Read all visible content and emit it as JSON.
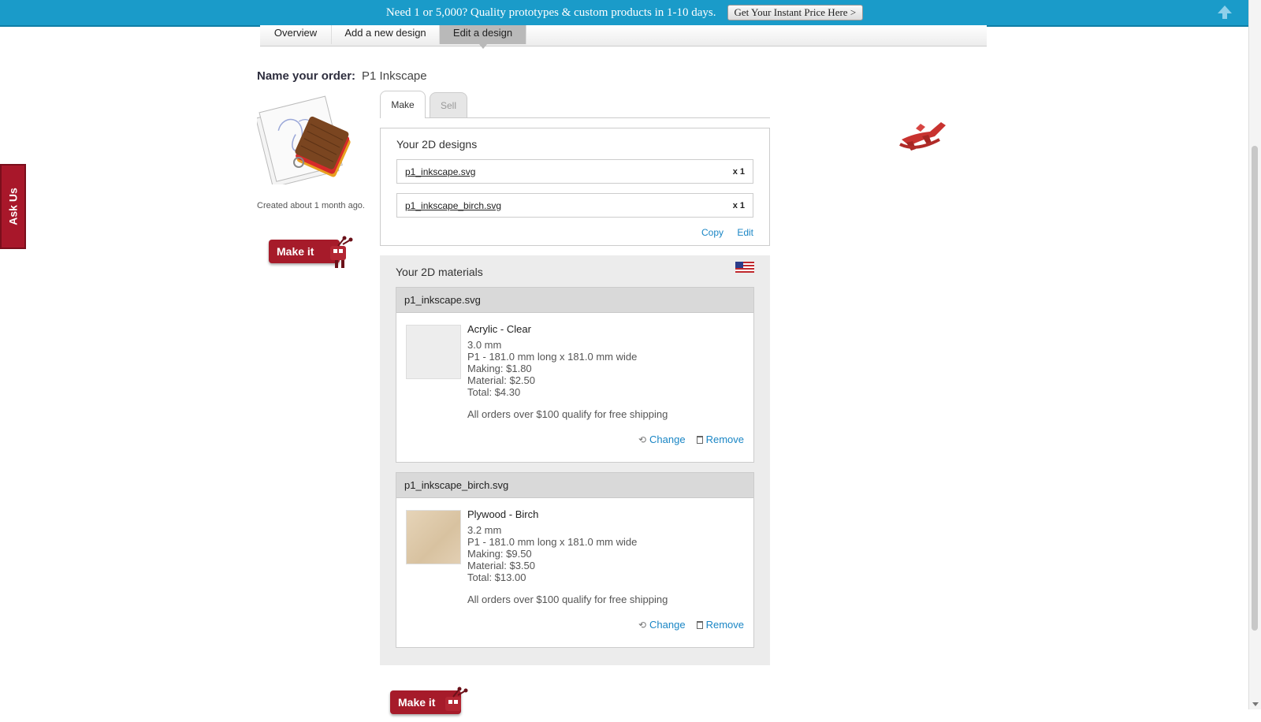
{
  "promo": {
    "text": "Need 1 or 5,000? Quality prototypes & custom products in 1-10 days.",
    "button": "Get Your Instant Price Here >"
  },
  "subnav": {
    "items": [
      "Overview",
      "Add a new design",
      "Edit a design"
    ],
    "active": "Edit a design"
  },
  "side_tab": "Ask Us",
  "order": {
    "label": "Name your order:",
    "name": "P1 Inkscape",
    "created": "Created about 1 month ago.",
    "make_it": "Make it"
  },
  "tabs": {
    "make": "Make",
    "sell": "Sell"
  },
  "designs": {
    "title": "Your 2D designs",
    "files": [
      {
        "name": "p1_inkscape.svg",
        "qty": "x 1"
      },
      {
        "name": "p1_inkscape_birch.svg",
        "qty": "x 1"
      }
    ],
    "copy": "Copy",
    "edit": "Edit"
  },
  "materials": {
    "title": "Your 2D materials",
    "flag": "us-flag-icon",
    "cards": [
      {
        "file": "p1_inkscape.svg",
        "material": "Acrylic - Clear",
        "thickness": "3.0 mm",
        "size": "P1 - 181.0 mm long x 181.0 mm wide",
        "making": "Making: $1.80",
        "material_cost": "Material: $2.50",
        "total": "Total: $4.30",
        "shipping": "All orders over $100 qualify for free shipping",
        "change": "Change",
        "remove": "Remove",
        "swatch_color": "#ededed"
      },
      {
        "file": "p1_inkscape_birch.svg",
        "material": "Plywood - Birch",
        "thickness": "3.2 mm",
        "size": "P1 - 181.0 mm long x 181.0 mm wide",
        "making": "Making: $9.50",
        "material_cost": "Material: $3.50",
        "total": "Total: $13.00",
        "shipping": "All orders over $100 qualify for free shipping",
        "change": "Change",
        "remove": "Remove",
        "swatch_color": "#e2cfb3"
      }
    ]
  },
  "colors": {
    "banner": "#1a9bc9",
    "brand_red": "#a61b2a",
    "link": "#1a86c5"
  }
}
